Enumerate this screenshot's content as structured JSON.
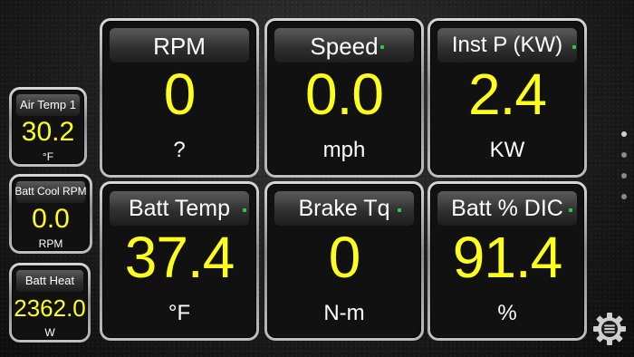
{
  "gauges": [
    {
      "label": "RPM",
      "value": "0",
      "unit": "?"
    },
    {
      "label": "Speed",
      "value": "0.0",
      "unit": "mph"
    },
    {
      "label": "Inst P (KW)",
      "value": "2.4",
      "unit": "KW"
    },
    {
      "label": "Batt Temp",
      "value": "37.4",
      "unit": "°F"
    },
    {
      "label": "Brake Tq",
      "value": "0",
      "unit": "N-m"
    },
    {
      "label": "Batt % DIC",
      "value": "91.4",
      "unit": "%"
    }
  ],
  "side_gauges": [
    {
      "label": "Air Temp 1",
      "value": "30.2",
      "unit": "°F"
    },
    {
      "label": "Batt Cool RPM",
      "value": "0.0",
      "unit": "RPM"
    },
    {
      "label": "Batt Heat",
      "value": "2362.0",
      "unit": "W"
    }
  ],
  "colors": {
    "value": "#ffff1e",
    "status_dot": "#2ecc40"
  },
  "pages": {
    "total": 4,
    "active": 0
  },
  "icons": {
    "menu": "settings-gear-icon"
  }
}
